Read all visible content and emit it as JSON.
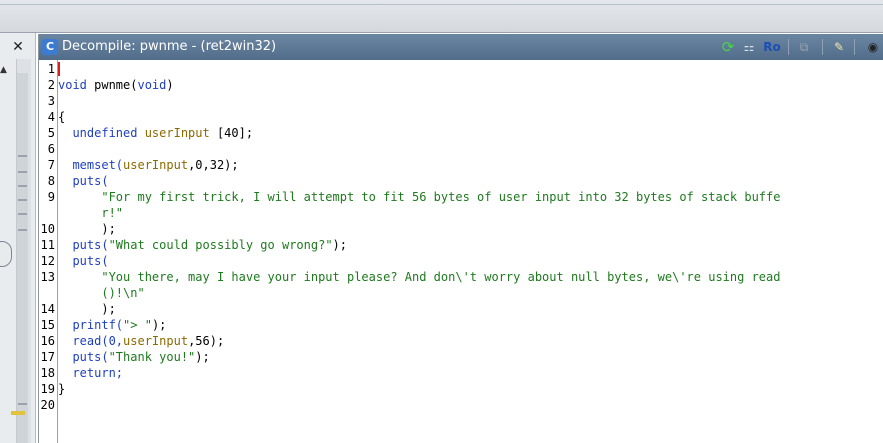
{
  "window": {
    "title": "Decompile: pwnme -  (ret2win32)",
    "icon_label": "C",
    "toolbar": {
      "refresh": "⟳",
      "graph": "⚏",
      "ro_label": "Ro",
      "copy": "⧉",
      "edit": "✎",
      "snapshot": "◉"
    }
  },
  "left_panel": {
    "close_label": "✕",
    "scroll_up": "▲"
  },
  "line_numbers": [
    "1",
    "2",
    "3",
    "4",
    "5",
    "6",
    "7",
    "8",
    "9",
    "",
    "10",
    "11",
    "12",
    "13",
    "",
    "14",
    "15",
    "16",
    "17",
    "18",
    "19",
    "20"
  ],
  "code": {
    "l2a": "void",
    "l2b": " pwnme(",
    "l2c": "void",
    "l2d": ")",
    "l4": "{",
    "l5a": "  undefined",
    "l5b": " userInput",
    "l5c": " [40];",
    "l7a": "  memset(",
    "l7b": "userInput",
    "l7c": ",0,32);",
    "l8": "  puts(",
    "l9": "      \"For my first trick, I will attempt to fit 56 bytes of user input into 32 bytes of stack buffe",
    "l9b": "      r!\"",
    "l10": "      );",
    "l11a": "  puts(",
    "l11b": "\"What could possibly go wrong?\"",
    "l11c": ");",
    "l12": "  puts(",
    "l13": "      \"You there, may I have your input please? And don\\'t worry about null bytes, we\\'re using read",
    "l13b": "      ()!\\n\"",
    "l14": "      );",
    "l15a": "  printf(",
    "l15b": "\"> \"",
    "l15c": ");",
    "l16a": "  read(0,",
    "l16b": "userInput",
    "l16c": ",56);",
    "l17a": "  puts(",
    "l17b": "\"Thank you!\"",
    "l17c": ");",
    "l18": "  return;",
    "l19": "}"
  }
}
